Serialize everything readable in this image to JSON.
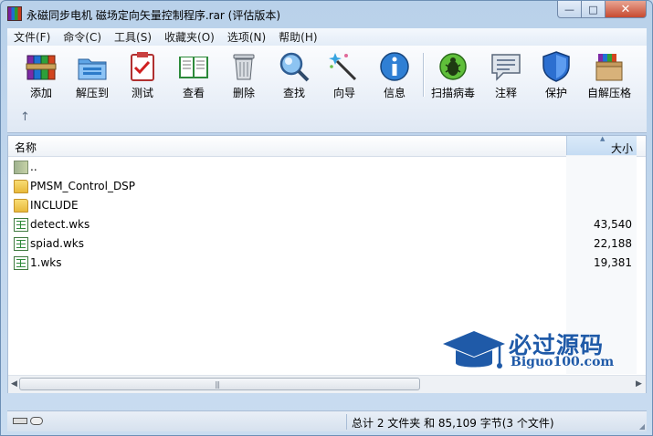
{
  "window": {
    "title": "永磁同步电机 磁场定向矢量控制程序.rar (评估版本)",
    "caption": {
      "minimize": "—",
      "maximize": "□",
      "close": "✕"
    }
  },
  "menu": [
    "文件(F)",
    "命令(C)",
    "工具(S)",
    "收藏夹(O)",
    "选项(N)",
    "帮助(H)"
  ],
  "toolbar": {
    "add": "添加",
    "extract": "解压到",
    "test": "测试",
    "view": "查看",
    "delete": "删除",
    "find": "查找",
    "wizard": "向导",
    "info": "信息",
    "virus_scan": "扫描病毒",
    "comment": "注释",
    "protect": "保护",
    "sfx": "自解压格",
    "up_arrow": "↑"
  },
  "columns": {
    "name": "名称",
    "size": "大小",
    "sort_indicator": "▲"
  },
  "files": [
    {
      "name": "..",
      "size": "",
      "icon": "folder-up-icon"
    },
    {
      "name": "PMSM_Control_DSP",
      "size": "",
      "icon": "folder-icon"
    },
    {
      "name": "INCLUDE",
      "size": "",
      "icon": "folder-icon"
    },
    {
      "name": "detect.wks",
      "size": "43,540",
      "icon": "spreadsheet-icon"
    },
    {
      "name": "spiad.wks",
      "size": "22,188",
      "icon": "spreadsheet-icon"
    },
    {
      "name": "1.wks",
      "size": "19,381",
      "icon": "spreadsheet-icon"
    }
  ],
  "scrollbar": {
    "left": "◀",
    "right": "▶",
    "grip": "|||"
  },
  "status": {
    "text": "总计 2 文件夹 和 85,109 字节(3 个文件)"
  },
  "watermark": {
    "title": "必过源码",
    "subtitle": "Biguo100.com"
  },
  "colors": {
    "accent": "#1f5aa8",
    "folder": "#e8b93b",
    "frame": "#b9d1ea"
  }
}
